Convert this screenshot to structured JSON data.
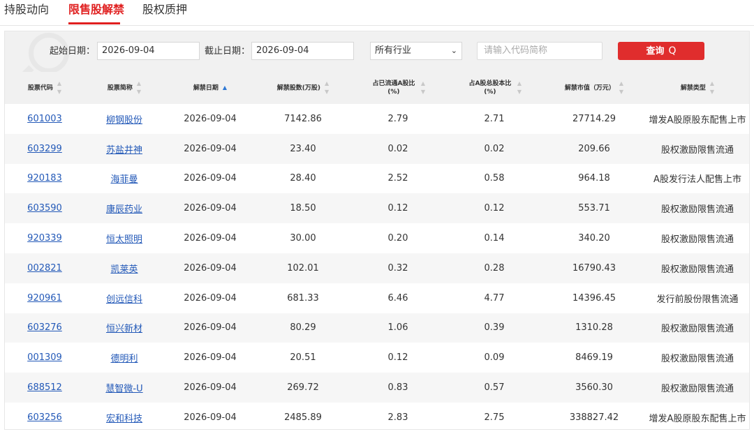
{
  "tabs": [
    {
      "label": "持股动向"
    },
    {
      "label": "限售股解禁"
    },
    {
      "label": "股权质押"
    }
  ],
  "active_tab": "限售股解禁",
  "filter": {
    "start_label": "起始日期：",
    "start_value": "2026-09-04",
    "end_label": "截止日期：",
    "end_value": "2026-09-04",
    "industry_selected": "所有行业",
    "search_placeholder": "请输入代码简称",
    "query_label": "查询",
    "query_icon": "Q"
  },
  "table": {
    "headers": [
      {
        "label": "股票代码",
        "sort": "none"
      },
      {
        "label": "股票简称",
        "sort": "none"
      },
      {
        "label": "解禁日期",
        "sort": "asc"
      },
      {
        "label": "解禁股数(万股)",
        "sort": "none"
      },
      {
        "label": "占已流通A股比(%)",
        "sort": "none"
      },
      {
        "label": "占A股总股本比(%)",
        "sort": "none"
      },
      {
        "label": "解禁市值（万元）",
        "sort": "none"
      },
      {
        "label": "解禁类型",
        "sort": "none"
      }
    ],
    "rows": [
      {
        "code": "601003",
        "name": "柳钢股份",
        "date": "2026-09-04",
        "shares": "7142.86",
        "float_pct": "2.79",
        "total_pct": "2.71",
        "value": "27714.29",
        "type": "增发A股原股东配售上市"
      },
      {
        "code": "603299",
        "name": "苏盐井神",
        "date": "2026-09-04",
        "shares": "23.40",
        "float_pct": "0.02",
        "total_pct": "0.02",
        "value": "209.66",
        "type": "股权激励限售流通"
      },
      {
        "code": "920183",
        "name": "海菲曼",
        "date": "2026-09-04",
        "shares": "28.40",
        "float_pct": "2.52",
        "total_pct": "0.58",
        "value": "964.18",
        "type": "A股发行法人配售上市"
      },
      {
        "code": "603590",
        "name": "康辰药业",
        "date": "2026-09-04",
        "shares": "18.50",
        "float_pct": "0.12",
        "total_pct": "0.12",
        "value": "553.71",
        "type": "股权激励限售流通"
      },
      {
        "code": "920339",
        "name": "恒太照明",
        "date": "2026-09-04",
        "shares": "30.00",
        "float_pct": "0.20",
        "total_pct": "0.14",
        "value": "340.20",
        "type": "股权激励限售流通"
      },
      {
        "code": "002821",
        "name": "凯莱英",
        "date": "2026-09-04",
        "shares": "102.01",
        "float_pct": "0.32",
        "total_pct": "0.28",
        "value": "16790.43",
        "type": "股权激励限售流通"
      },
      {
        "code": "920961",
        "name": "创远信科",
        "date": "2026-09-04",
        "shares": "681.33",
        "float_pct": "6.46",
        "total_pct": "4.77",
        "value": "14396.45",
        "type": "发行前股份限售流通"
      },
      {
        "code": "603276",
        "name": "恒兴新材",
        "date": "2026-09-04",
        "shares": "80.29",
        "float_pct": "1.06",
        "total_pct": "0.39",
        "value": "1310.28",
        "type": "股权激励限售流通"
      },
      {
        "code": "001309",
        "name": "德明利",
        "date": "2026-09-04",
        "shares": "20.51",
        "float_pct": "0.12",
        "total_pct": "0.09",
        "value": "8469.19",
        "type": "股权激励限售流通"
      },
      {
        "code": "688512",
        "name": "慧智微-U",
        "date": "2026-09-04",
        "shares": "269.72",
        "float_pct": "0.83",
        "total_pct": "0.57",
        "value": "3560.30",
        "type": "股权激励限售流通"
      },
      {
        "code": "603256",
        "name": "宏和科技",
        "date": "2026-09-04",
        "shares": "2485.89",
        "float_pct": "2.83",
        "total_pct": "2.75",
        "value": "338827.42",
        "type": "增发A股原股东配售上市"
      }
    ]
  },
  "colors": {
    "accent": "#e02020",
    "link": "#2359b8",
    "query_button": "#e02d2d",
    "sort_active": "#2e78d4"
  }
}
